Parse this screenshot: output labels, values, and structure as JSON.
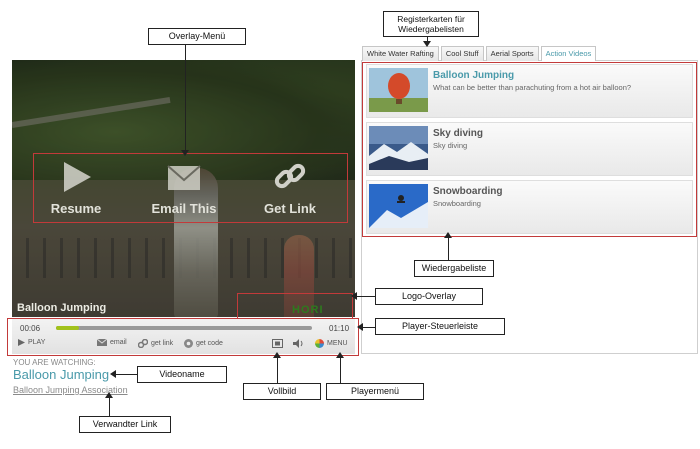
{
  "video": {
    "overlay_menu": {
      "resume_label": "Resume",
      "email_label": "Email This",
      "getlink_label": "Get Link"
    },
    "title": "Balloon Jumping",
    "logo_text": "HORI"
  },
  "controls": {
    "elapsed": "00:06",
    "duration": "01:10",
    "progress_fraction": 0.09,
    "play_label": "PLAY",
    "email_label": "email",
    "getlink_label": "get link",
    "getcode_label": "get code",
    "menu_label": "MENU"
  },
  "watching": {
    "label": "YOU ARE WATCHING:",
    "title": "Balloon Jumping",
    "related_link": "Balloon Jumping Association"
  },
  "playlist": {
    "tabs": [
      {
        "label": "White Water Rafting",
        "active": false
      },
      {
        "label": "Cool Stuff",
        "active": false
      },
      {
        "label": "Aerial Sports",
        "active": false
      },
      {
        "label": "Action Videos",
        "active": true
      }
    ],
    "items": [
      {
        "title": "Balloon Jumping",
        "desc": "What can be better than parachuting from a hot air balloon?"
      },
      {
        "title": "Sky diving",
        "desc": "Sky diving"
      },
      {
        "title": "Snowboarding",
        "desc": "Snowboarding"
      }
    ]
  },
  "annotations": {
    "overlay_menu": "Overlay-Menü",
    "tabs": "Registerkarten für\nWiedergabelisten",
    "playlist": "Wiedergabeliste",
    "logo_overlay": "Logo-Overlay",
    "controls_bar": "Player-Steuerleiste",
    "video_name": "Videoname",
    "fullscreen": "Vollbild",
    "player_menu": "Playermenü",
    "related_link": "Verwandter Link"
  },
  "colors": {
    "accent": "#4a9aaa",
    "progress": "#a2c21c",
    "annotation_border": "#c23a3a"
  }
}
